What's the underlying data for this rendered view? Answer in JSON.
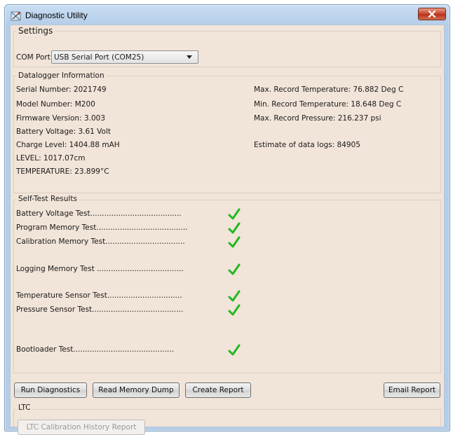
{
  "window": {
    "title": "Diagnostic Utility",
    "close_icon": "close-icon"
  },
  "settings": {
    "group_label": "Settings",
    "com_port_label": "COM Port:",
    "com_port_value": "USB Serial Port (COM25)"
  },
  "datalogger": {
    "group_label": "Datalogger Information",
    "left": [
      "Serial Number: 2021749",
      "Model Number: M200",
      "Firmware Version: 3.003",
      "Battery Voltage: 3.61 Volt",
      "Charge Level: 1404.88 mAH",
      "LEVEL: 1017.07cm",
      "TEMPERATURE: 23.899°C"
    ],
    "right": [
      "Max. Record Temperature: 76.882 Deg C",
      "Min. Record Temperature: 18.648 Deg C",
      "Max. Record Pressure: 216.237 psi",
      "Estimate of data logs: 84905"
    ]
  },
  "self_test": {
    "group_label": "Self-Test Results",
    "tests": [
      "Battery Voltage Test.......................................",
      "Program Memory Test.......................................",
      "Calibration Memory Test..................................",
      "Logging Memory Test .....................................",
      "Temperature Sensor Test................................",
      "Pressure Sensor Test.......................................",
      "Bootloader Test..........................................."
    ],
    "result_icon": "checkmark-icon",
    "check_color": "#22b822"
  },
  "actions": {
    "run_diagnostics": "Run Diagnostics",
    "read_memory_dump": "Read Memory Dump",
    "create_report": "Create Report",
    "email_report": "Email Report"
  },
  "ltc": {
    "group_label": "LTC",
    "history_report": "LTC Calibration History Report"
  },
  "colors": {
    "panel_bg": "#f1e4d8",
    "titlebar": "#b4cde8",
    "close_button": "#c6432b"
  }
}
